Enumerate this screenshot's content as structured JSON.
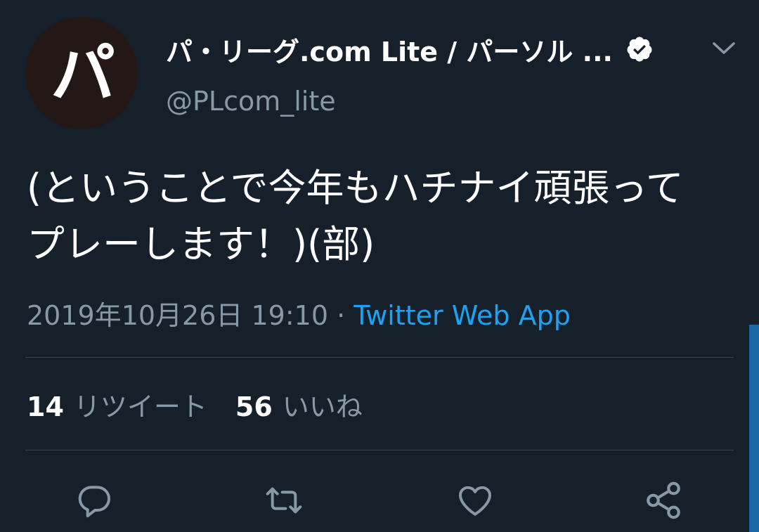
{
  "author": {
    "avatar_text": "パ",
    "display_name": "パ・リーグ.com Lite / パーソル ...",
    "handle": "@PLcom_lite"
  },
  "tweet": {
    "text": "(ということで今年もハチナイ頑張ってプレーします！)(部)",
    "timestamp": "2019年10月26日 19:10",
    "separator": " · ",
    "source": "Twitter Web App"
  },
  "stats": {
    "retweets_count": "14",
    "retweets_label": "リツイート",
    "likes_count": "56",
    "likes_label": "いいね"
  },
  "icons": {
    "verified": "verified-badge-icon",
    "menu": "chevron-down-icon",
    "reply": "reply-icon",
    "retweet": "retweet-icon",
    "like": "heart-icon",
    "share": "share-icon"
  },
  "colors": {
    "background": "#15202b",
    "accent": "#1da1f2",
    "secondary_text": "#8899a6",
    "divider": "#38444d"
  }
}
